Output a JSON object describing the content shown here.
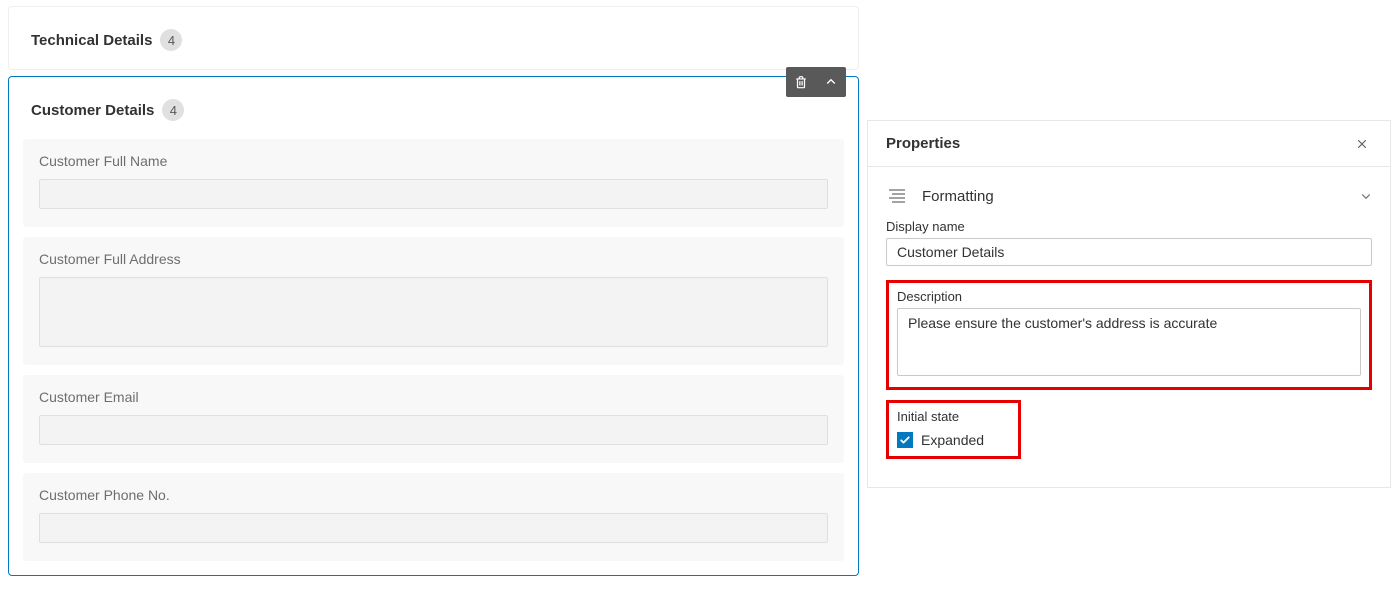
{
  "sections": [
    {
      "title": "Technical Details",
      "count": "4"
    },
    {
      "title": "Customer Details",
      "count": "4"
    }
  ],
  "fields": [
    {
      "label": "Customer Full Name",
      "kind": "text"
    },
    {
      "label": "Customer Full Address",
      "kind": "textarea"
    },
    {
      "label": "Customer Email",
      "kind": "text"
    },
    {
      "label": "Customer Phone No.",
      "kind": "text"
    }
  ],
  "panel": {
    "title": "Properties",
    "formatting_label": "Formatting",
    "display_name_label": "Display name",
    "display_name_value": "Customer Details",
    "description_label": "Description",
    "description_value": "Please ensure the customer's address is accurate",
    "initial_state_label": "Initial state",
    "expanded_label": "Expanded"
  }
}
